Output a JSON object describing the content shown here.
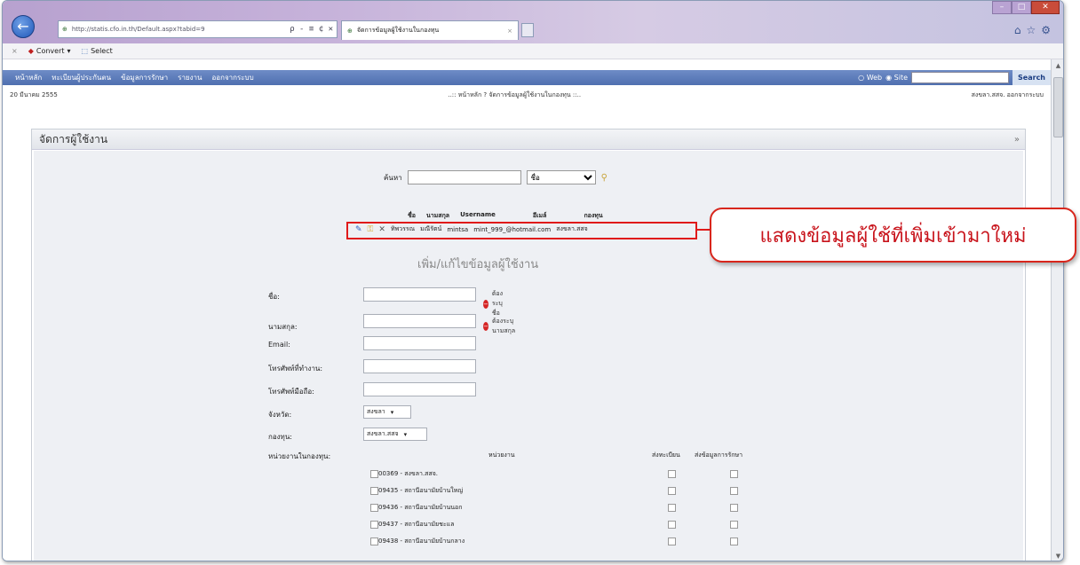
{
  "browser": {
    "address_url": "http://statis.cfo.in.th/Default.aspx?tabid=9",
    "address_controls": "ρ - ≡ ¢ ✕",
    "tab_title": "จัดการข้อมูลผู้ใช้งานในกองทุน",
    "toolbar": {
      "convert_label": "Convert",
      "select_label": "Select"
    }
  },
  "site_nav": {
    "items": [
      "หน้าหลัก",
      "ทะเบียนผู้ประกันตน",
      "ข้อมูลการรักษา",
      "รายงาน",
      "ออกจากระบบ"
    ],
    "search_option_web": "Web",
    "search_option_site": "Site",
    "search_button": "Search"
  },
  "info": {
    "date": "20 มีนาคม 2555",
    "breadcrumb": "..:: หน้าหลัก ? จัดการข้อมูลผู้ใช้งานในกองทุน ::..",
    "user": "สงขลา.สสจ. ออกจากระบบ"
  },
  "panel": {
    "title": "จัดการผู้ใช้งาน",
    "collapse": "»"
  },
  "search": {
    "label": "ค้นหา",
    "field_option": "ชื่อ"
  },
  "user_table": {
    "headers": [
      "ชื่อ",
      "นามสกุล",
      "Username",
      "อีเมล์",
      "กองทุน"
    ],
    "row": {
      "name": "ทิพวรรณ",
      "surname": "มณีรัตน์",
      "username": "mintsa",
      "email": "mint_999_@hotmail.com",
      "fund": "สงขลา.สสจ"
    }
  },
  "callout": {
    "text": "แสดงข้อมูลผู้ใช้ที่เพิ่มเข้ามาใหม่"
  },
  "form": {
    "title": "เพิ่ม/แก้ไขข้อมูลผู้ใช้งาน",
    "first_name": "ชื่อ:",
    "last_name": "นามสกุล:",
    "email": "Email:",
    "work_phone": "โทรศัพท์ที่ทำงาน:",
    "mobile": "โทรศัพท์มือถือ:",
    "province": "จังหวัด:",
    "fund": "กองทุน:",
    "fund_units": "หน่วยงานในกองทุน:",
    "first_name_required": "ต้องระบุชื่อ",
    "last_name_required": "ต้องระบุนามสกุล",
    "province_value": "สงขลา",
    "fund_value": "สงขลา.สสจ"
  },
  "units": {
    "header_unit": "หน่วยงาน",
    "header_register": "ส่งทะเบียน",
    "header_treatment": "ส่งข้อมูลการรักษา",
    "rows": [
      "00369 - สงขลา.สสจ.",
      "09435 - สถานีอนามัยบ้านใหญ่",
      "09436 - สถานีอนามัยบ้านนอก",
      "09437 - สถานีอนามัยชะแล",
      "09438 - สถานีอนามัยบ้านกลาง"
    ]
  }
}
